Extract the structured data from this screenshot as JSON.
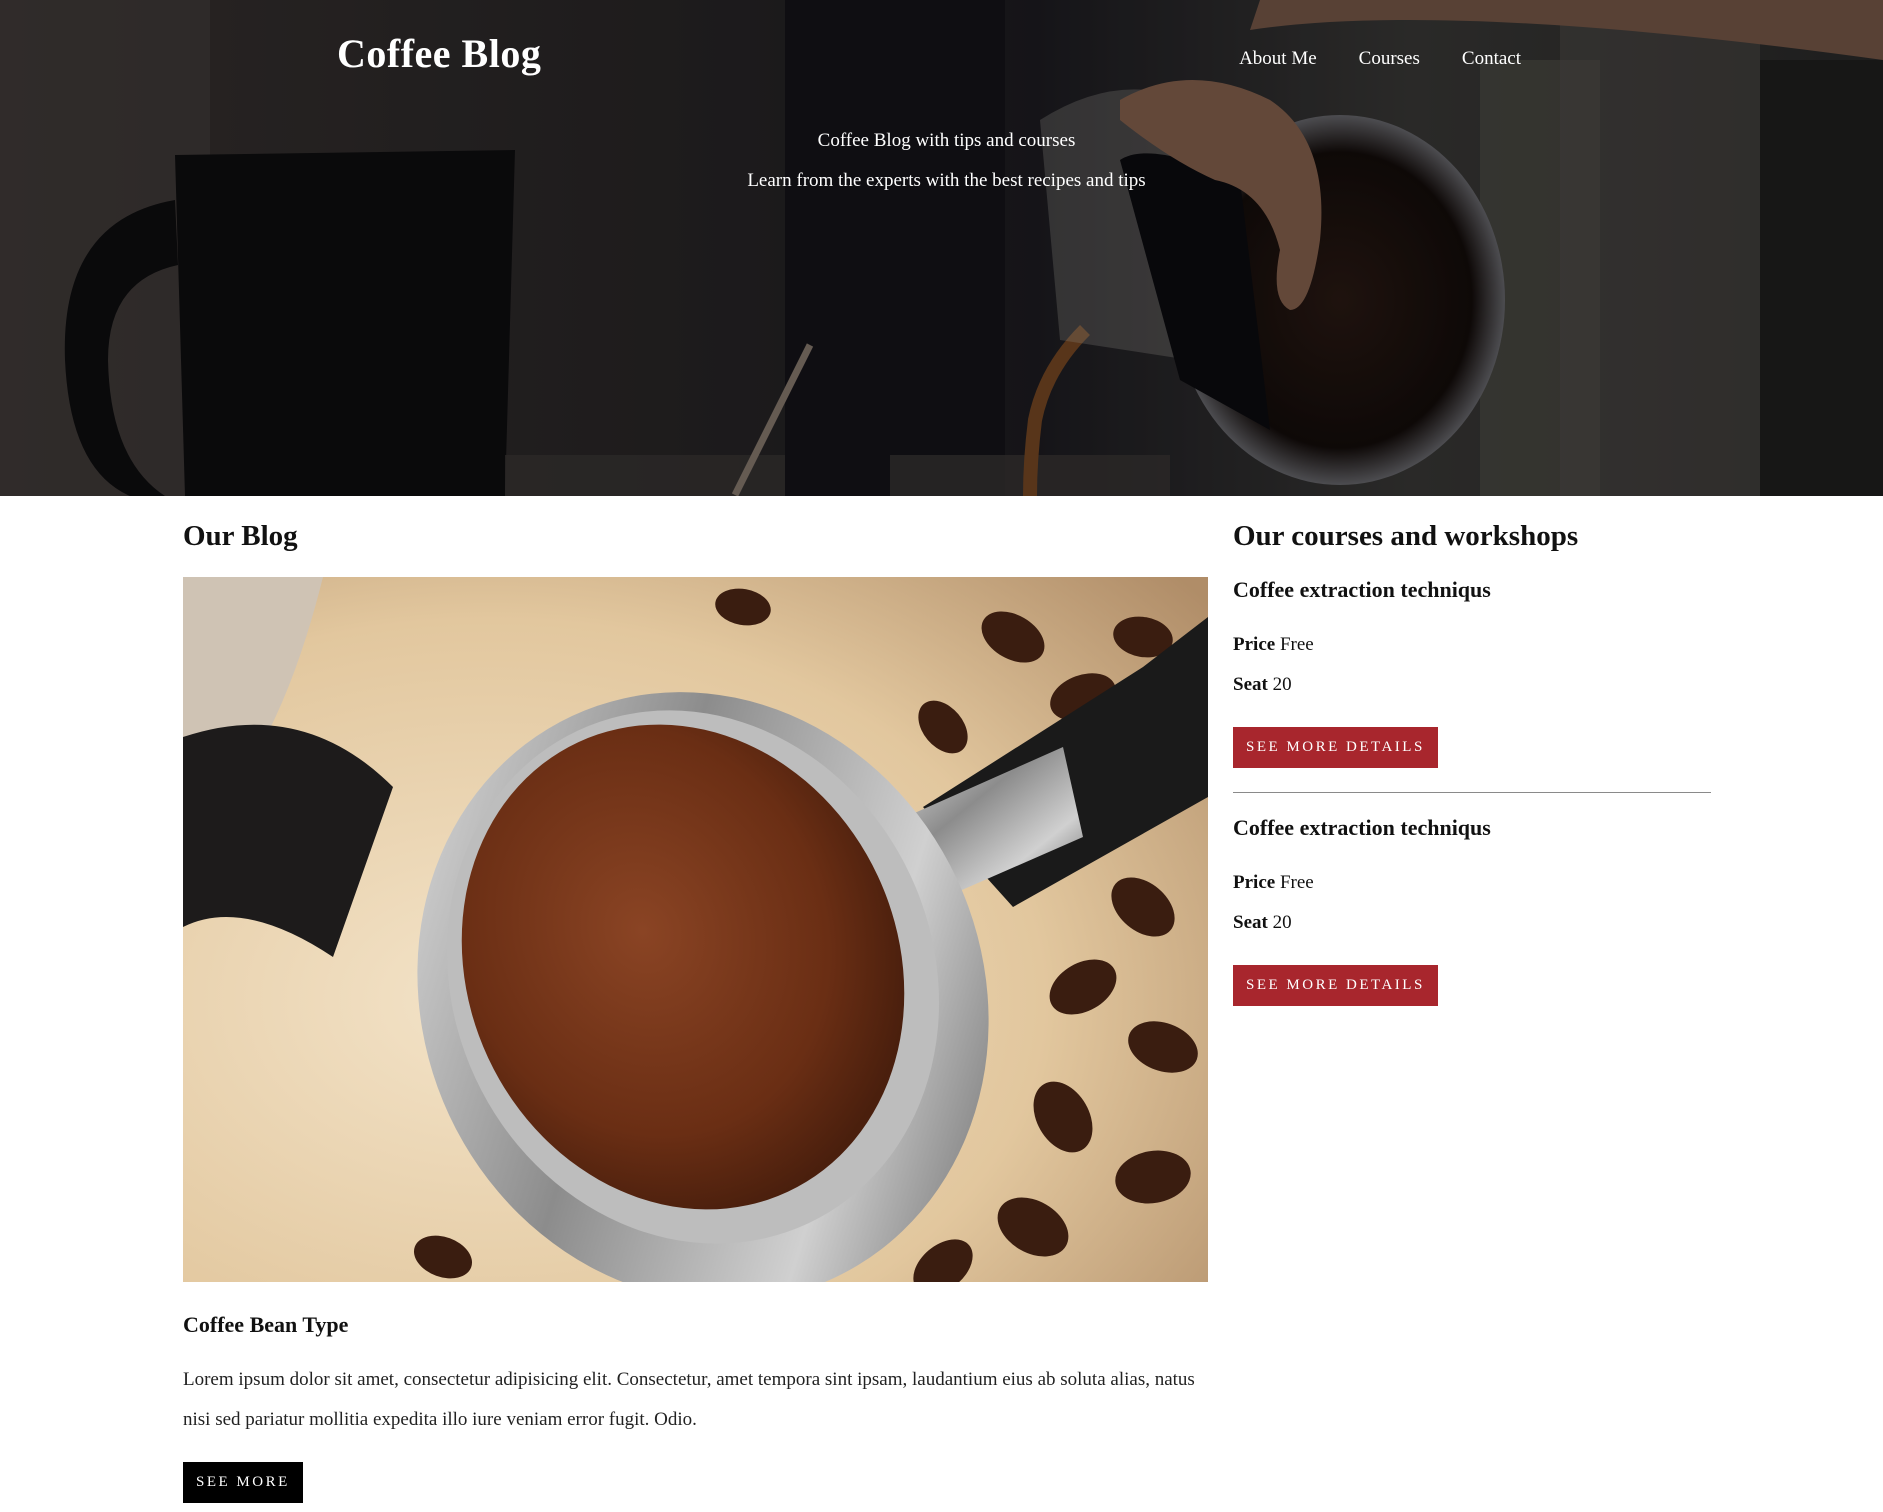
{
  "header": {
    "title": "Coffee Blog",
    "nav": [
      "About Me",
      "Courses",
      "Contact"
    ],
    "tagline_1": "Coffee Blog with tips and courses",
    "tagline_2": "Learn from the experts with the best recipes and tips"
  },
  "blog": {
    "heading": "Our Blog",
    "image_icon": "portafilter-with-ground-coffee-photo",
    "post": {
      "title": "Coffee Bean Type",
      "excerpt": "Lorem ipsum dolor sit amet, consectetur adipisicing elit. Consectetur, amet tempora sint ipsam, laudantium eius ab soluta alias, natus nisi sed pariatur mollitia expedita illo iure veniam error fugit. Odio.",
      "button": "See More"
    }
  },
  "courses": {
    "heading": "Our courses and workshops",
    "items": [
      {
        "title": "Coffee extraction techniqus",
        "price_label": "Price",
        "price": "Free",
        "seat_label": "Seat",
        "seat": "20",
        "button": "See More Details"
      },
      {
        "title": "Coffee extraction techniqus",
        "price_label": "Price",
        "price": "Free",
        "seat_label": "Seat",
        "seat": "20",
        "button": "See More Details"
      }
    ]
  },
  "colors": {
    "accent": "#a8262d",
    "dark_button": "#000000",
    "hero_overlay": "#1b1b1e"
  }
}
